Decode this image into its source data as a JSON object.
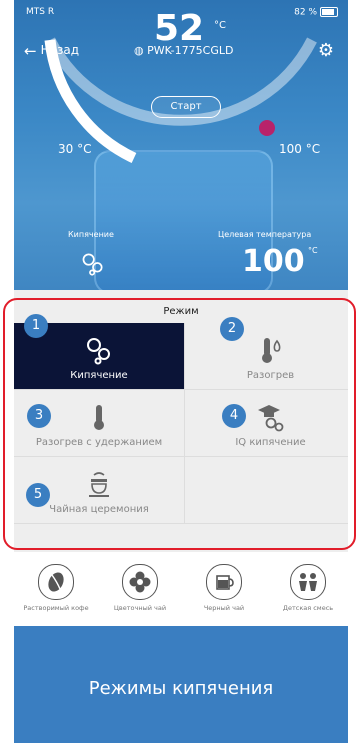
{
  "status_bar": {
    "carrier": "MTS R",
    "battery": "82 %"
  },
  "header": {
    "back_label": "Назад",
    "device_name": "PWK-1775CGLD"
  },
  "hero": {
    "current_temperature": "52",
    "temperature_unit": "°C",
    "start_label": "Старт",
    "min_label": "30 °C",
    "max_label": "100 °C",
    "current_mode_label": "Кипячение",
    "target_label": "Целевая температура",
    "target_value": "100",
    "target_unit": "°C"
  },
  "modes": {
    "title": "Режим",
    "items": [
      {
        "number": "1",
        "label": "Кипячение",
        "icon": "boil-bubbles-icon",
        "selected": true
      },
      {
        "number": "2",
        "label": "Разогрев",
        "icon": "thermometer-flame-icon",
        "selected": false
      },
      {
        "number": "3",
        "label": "Разогрев с удержанием",
        "icon": "thermometer-icon",
        "selected": false
      },
      {
        "number": "4",
        "label": "IQ кипячение",
        "icon": "graduation-cap-bubbles-icon",
        "selected": false
      },
      {
        "number": "5",
        "label": "Чайная церемония",
        "icon": "teapot-icon",
        "selected": false
      }
    ]
  },
  "presets": [
    {
      "label": "Растворимый кофе",
      "icon": "coffee-bean-icon"
    },
    {
      "label": "Цветочный чай",
      "icon": "flower-icon"
    },
    {
      "label": "Черный чай",
      "icon": "tea-cup-icon"
    },
    {
      "label": "Детская смесь",
      "icon": "children-icon"
    }
  ],
  "banner": {
    "text": "Режимы кипячения"
  },
  "colors": {
    "accent": "#3a7ec1",
    "selected": "#0b1437",
    "outline": "#e11d2a",
    "indicator": "#b8236a"
  }
}
